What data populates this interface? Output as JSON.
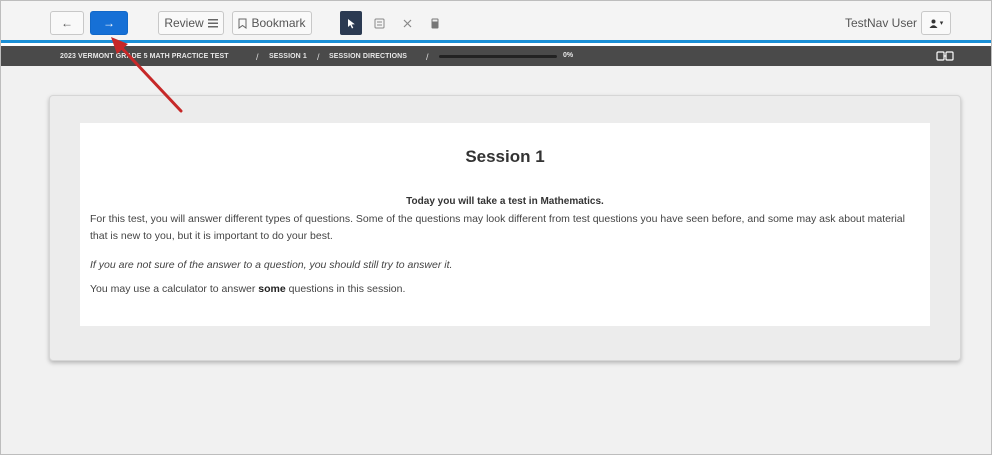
{
  "toolbar": {
    "back_glyph": "←",
    "next_glyph": "→",
    "review_label": "Review",
    "review_icon": "list-icon",
    "bookmark_label": "Bookmark",
    "bookmark_icon": "bookmark-icon",
    "tools": [
      {
        "name": "pointer-tool",
        "icon": "cursor-icon",
        "active": true
      },
      {
        "name": "answer-eliminator-tool",
        "icon": "eliminator-icon",
        "active": false
      },
      {
        "name": "close-tool",
        "icon": "close-icon",
        "active": false
      },
      {
        "name": "calculator-tool",
        "icon": "calculator-icon",
        "active": false
      }
    ],
    "user_name": "TestNav User",
    "accent_color": "#1a8fd6",
    "next_button_color": "#1670d6"
  },
  "breadcrumb": {
    "items": [
      "2023 VERMONT GRADE 5 MATH PRACTICE TEST",
      "SESSION 1",
      "SESSION DIRECTIONS"
    ],
    "separator": "/",
    "progress_percent": 0,
    "progress_text": "0%",
    "right_icon": "line-reader-icon"
  },
  "main": {
    "title": "Session 1",
    "intro": "Today you will take a test in Mathematics.",
    "paragraph1": "For this test, you will answer different types of questions. Some of the questions may look different from test questions you have seen before, and some may ask about material that is new to you, but it is important to do your best.",
    "paragraph2": "If you are not sure of the answer to a question, you should still try to answer it.",
    "paragraph3_before": "You may use a calculator to answer ",
    "paragraph3_bold": "some",
    "paragraph3_after": " questions in this session."
  },
  "annotation": {
    "type": "red-arrow",
    "color": "#c62828",
    "points_to": "next-button"
  }
}
